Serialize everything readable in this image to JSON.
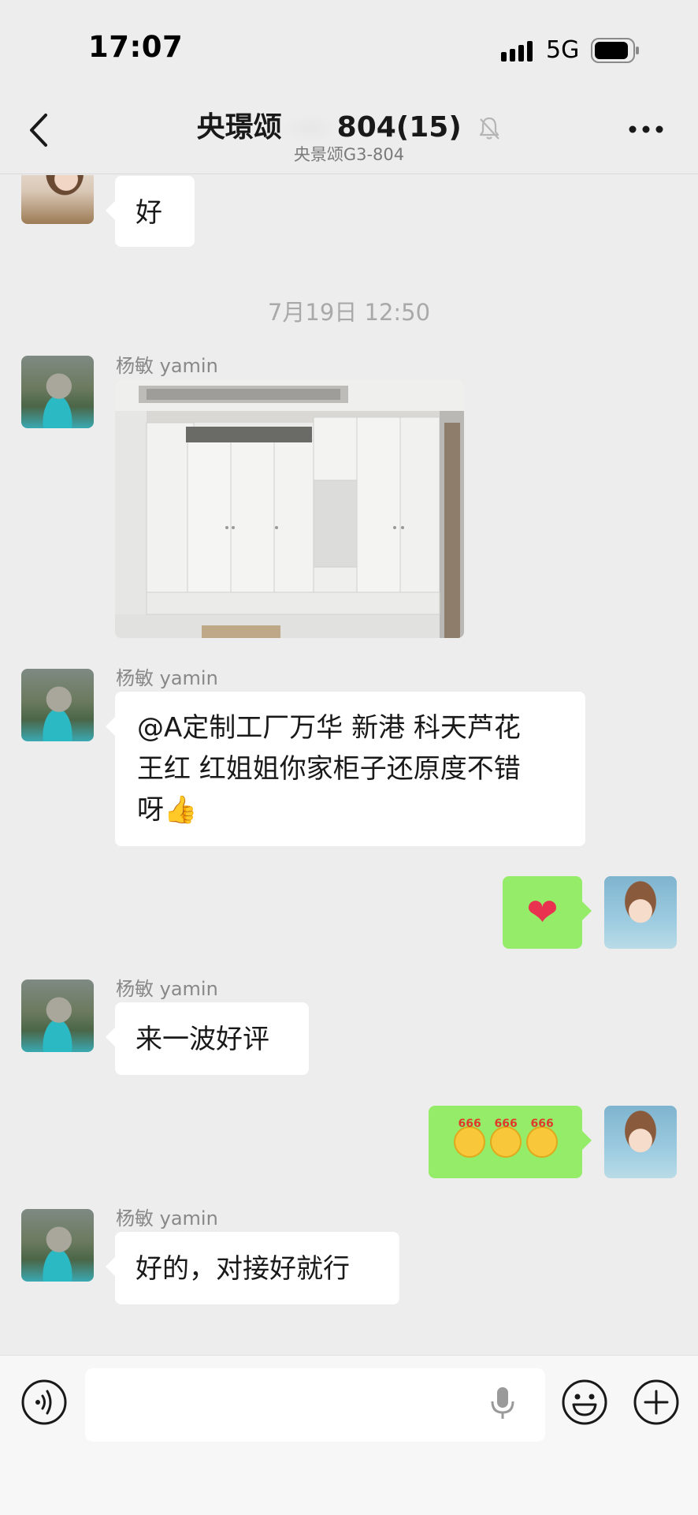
{
  "status_bar": {
    "time": "17:07",
    "network": "5G"
  },
  "header": {
    "title": "央璟颂",
    "title_suffix": "804(15)",
    "subtitle": "央景颂G3-804"
  },
  "messages": [
    {
      "side": "left",
      "text": "好"
    },
    {
      "timestamp": "7月19日 12:50"
    },
    {
      "side": "left",
      "sender": "杨敏 yamin",
      "type": "image"
    },
    {
      "side": "left",
      "sender": "杨敏 yamin",
      "lines": [
        "@A定制工厂万华 新港 科天芦花",
        "王红 红姐姐你家柜子还原度不错",
        "呀👍"
      ]
    },
    {
      "side": "right",
      "type": "sticker",
      "content": "❤"
    },
    {
      "side": "left",
      "sender": "杨敏 yamin",
      "text": "来一波好评"
    },
    {
      "side": "right",
      "type": "emoji",
      "labels": [
        "666",
        "666",
        "666"
      ]
    },
    {
      "side": "left",
      "sender": "杨敏 yamin",
      "text": "好的，对接好就行"
    }
  ],
  "input": {
    "value": "",
    "placeholder": ""
  },
  "colors": {
    "chat_background": "#ededed",
    "self_bubble": "#95ec69",
    "other_bubble": "#ffffff"
  },
  "icons": [
    "signal-icon",
    "battery-icon",
    "back-arrow-icon",
    "mute-bell-icon",
    "more-dots-icon",
    "voice-icon",
    "microphone-icon",
    "emoji-icon",
    "plus-icon"
  ]
}
